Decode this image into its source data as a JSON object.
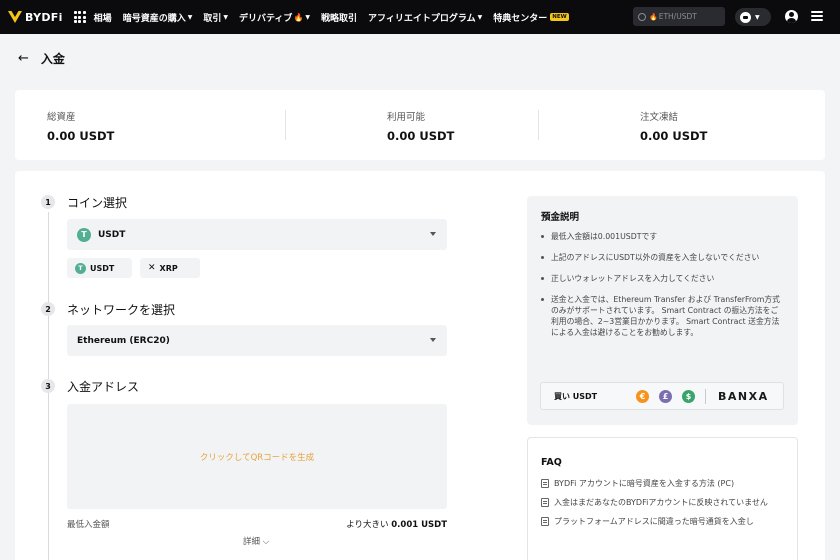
{
  "navbar": {
    "logo": "BYDFi",
    "items": [
      {
        "label": "相場",
        "caret": false
      },
      {
        "label": "暗号資産の購入",
        "caret": true
      },
      {
        "label": "取引",
        "caret": true
      },
      {
        "label": "デリバティブ",
        "caret": true,
        "hot": true
      },
      {
        "label": "戦略取引",
        "caret": false
      },
      {
        "label": "アフィリエイトプログラム",
        "caret": true
      },
      {
        "label": "特典センター",
        "caret": false,
        "badge": "NEW"
      }
    ],
    "search_placeholder": "ETH/USDT"
  },
  "page": {
    "title": "入金"
  },
  "balances": [
    {
      "label": "総資産",
      "value": "0.00 USDT"
    },
    {
      "label": "利用可能",
      "value": "0.00 USDT"
    },
    {
      "label": "注文凍結",
      "value": "0.00 USDT"
    }
  ],
  "steps": {
    "coin": {
      "number": "1",
      "title": "コイン選択",
      "selected": "USDT",
      "quick_chips": [
        "USDT",
        "XRP"
      ]
    },
    "network": {
      "number": "2",
      "title": "ネットワークを選択",
      "selected": "Ethereum (ERC20)"
    },
    "address": {
      "number": "3",
      "title": "入金アドレス",
      "qr_prompt": "クリックしてQRコードを生成"
    }
  },
  "minimum": {
    "label": "最低入金額",
    "prefix": "より大きい",
    "value": "0.001 USDT",
    "details": "詳細"
  },
  "notes": {
    "title": "預金説明",
    "items": [
      "最低入金額は0.001USDTです",
      "上記のアドレスにUSDT以外の資産を入金しないでください",
      "正しいウォレットアドレスを入力してください",
      "送金と入金では、Ethereum Transfer および TransferFrom方式のみがサポートされています。 Smart Contract の振込方法をご利用の場合、2~3営業日かかります。 Smart Contract 送金方法による入金は避けることをお勧めします。"
    ],
    "buy": {
      "label": "買い USDT",
      "provider": "BANXA"
    }
  },
  "faq": {
    "title": "FAQ",
    "items": [
      "BYDFi アカウントに暗号資産を入金する方法 (PC)",
      "入金はまだあなたのBYDFiアカウントに反映されていません",
      "プラットフォームアドレスに間違った暗号通貨を入金し"
    ]
  },
  "colors": {
    "navbar_bg": "#0b0b0e",
    "tether_green": "#53ae94",
    "qr_prompt": "#e8a33d",
    "badge_yellow": "#f5c518"
  }
}
